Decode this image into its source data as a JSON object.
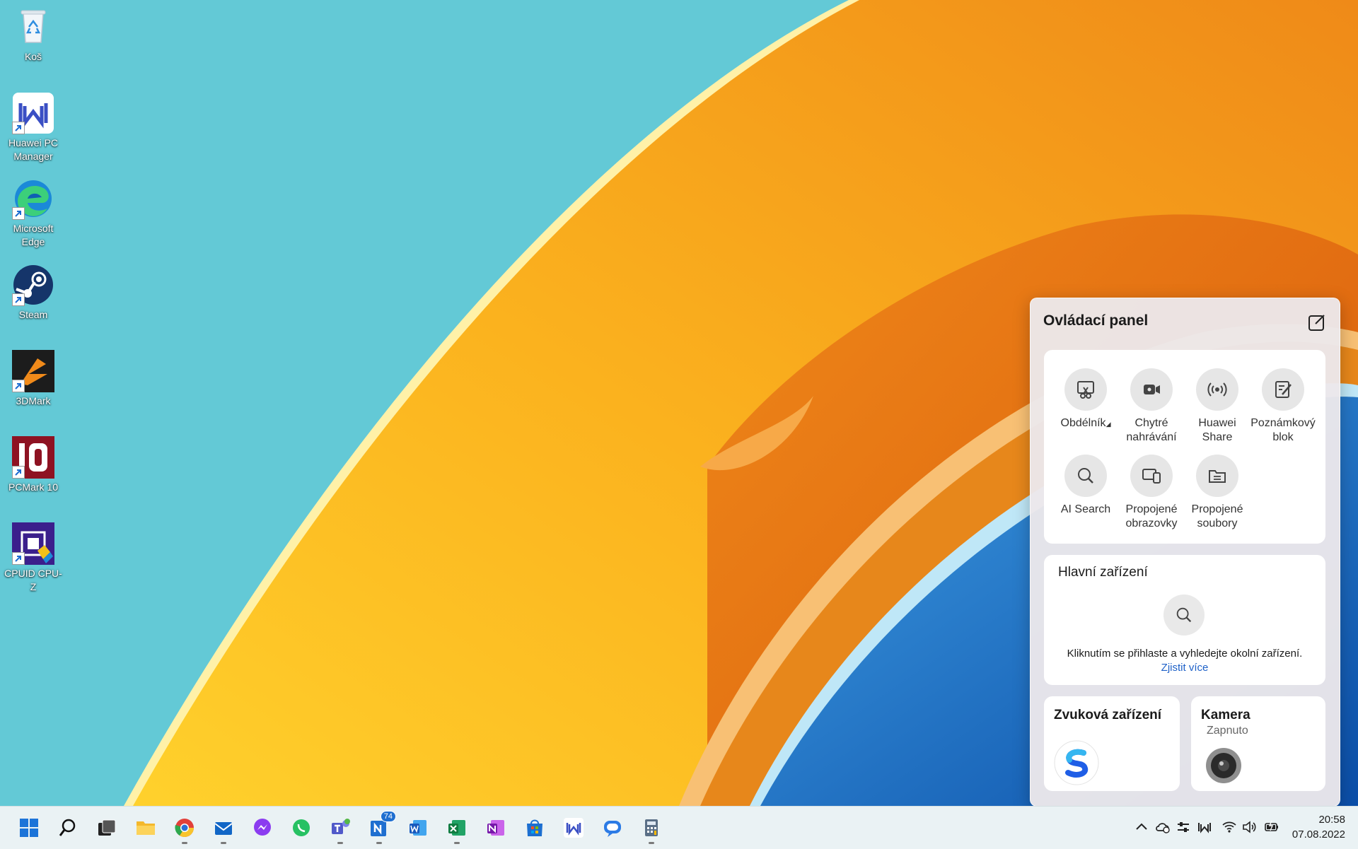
{
  "desktop": {
    "icons": [
      {
        "label": "Koš",
        "icon": "recycle-bin-icon"
      },
      {
        "label": "Huawei PC Manager",
        "icon": "huawei-pc-manager-icon"
      },
      {
        "label": "Microsoft Edge",
        "icon": "edge-icon"
      },
      {
        "label": "Steam",
        "icon": "steam-icon"
      },
      {
        "label": "3DMark",
        "icon": "3dmark-icon"
      },
      {
        "label": "PCMark 10",
        "icon": "pcmark-icon"
      },
      {
        "label": "CPUID CPU-Z",
        "icon": "cpuz-icon"
      }
    ]
  },
  "panel": {
    "title": "Ovládací panel",
    "tools": [
      {
        "label": "Obdélník",
        "icon": "scissors-icon",
        "has_dropdown": true
      },
      {
        "label": "Chytré nahrávání",
        "icon": "video-camera-icon"
      },
      {
        "label": "Huawei Share",
        "icon": "share-wave-icon"
      },
      {
        "label": "Poznámkový blok",
        "icon": "notepad-icon"
      },
      {
        "label": "AI Search",
        "icon": "search-icon"
      },
      {
        "label": "Propojené obrazovky",
        "icon": "multi-screen-icon"
      },
      {
        "label": "Propojené soubory",
        "icon": "folder-icon"
      }
    ],
    "device": {
      "title": "Hlavní zařízení",
      "hint": "Kliknutím se přihlaste a vyhledejte okolní zařízení.",
      "more_link": "Zjistit více"
    },
    "audio": {
      "title": "Zvuková zařízení"
    },
    "camera": {
      "title": "Kamera",
      "state": "Zapnuto"
    }
  },
  "taskbar": {
    "apps": [
      "start",
      "search",
      "task-view",
      "file-explorer",
      "chrome",
      "mail",
      "messenger",
      "whatsapp",
      "teams",
      "news",
      "word",
      "excel",
      "onenote",
      "store",
      "huawei-pc-manager",
      "feedback",
      "calculator"
    ],
    "news_badge": "74",
    "clock": {
      "time": "20:58",
      "date": "07.08.2022"
    }
  },
  "colors": {
    "accent": "#1e61c8",
    "wallpaper_bg": "#63c9d6",
    "orange": "#f28a1c",
    "blue": "#1669c9"
  }
}
